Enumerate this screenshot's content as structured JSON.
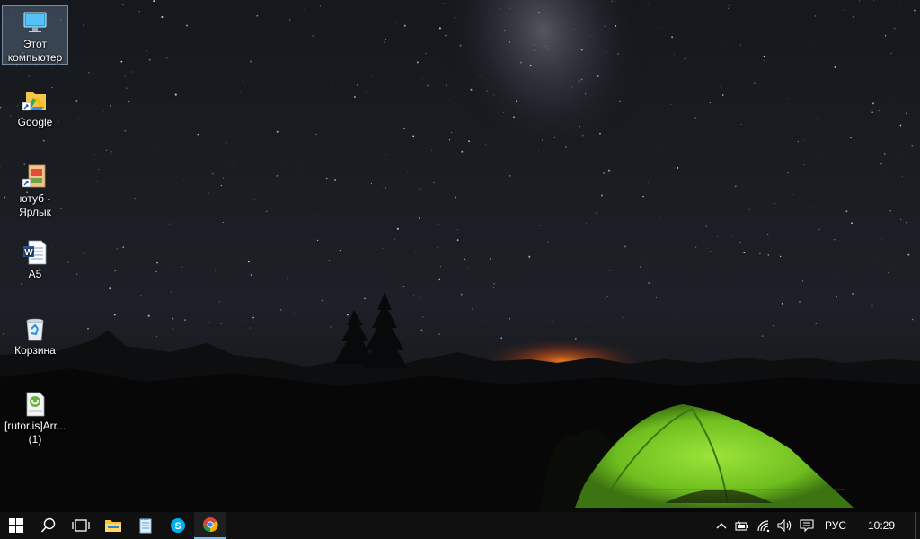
{
  "desktop": {
    "icons": [
      {
        "label": "Этот компьютер",
        "icon": "this-pc-icon",
        "selected": true
      },
      {
        "label": "Google",
        "icon": "google-drive-shortcut-icon"
      },
      {
        "label": "ютуб - Ярлык",
        "icon": "youtube-shortcut-icon"
      },
      {
        "label": "А5",
        "icon": "word-document-icon"
      },
      {
        "label": "Корзина",
        "icon": "recycle-bin-icon"
      },
      {
        "label": "[rutor.is]Arr... (1)",
        "icon": "torrent-file-icon"
      }
    ]
  },
  "taskbar": {
    "pinned": [
      {
        "name": "start-button",
        "icon": "windows-logo-icon"
      },
      {
        "name": "search-button",
        "icon": "search-icon"
      },
      {
        "name": "task-view-button",
        "icon": "task-view-icon"
      },
      {
        "name": "file-explorer-button",
        "icon": "folder-icon"
      },
      {
        "name": "notepad-button",
        "icon": "notepad-icon"
      },
      {
        "name": "skype-button",
        "icon": "skype-icon"
      },
      {
        "name": "chrome-button",
        "icon": "chrome-icon",
        "active": true
      }
    ],
    "tray": {
      "language": "РУС",
      "time": "10:29",
      "icons": [
        "chevron-up-icon",
        "battery-icon",
        "wifi-icon",
        "volume-icon",
        "action-center-icon"
      ]
    }
  },
  "colors": {
    "taskbar_bg": "#101010",
    "accent": "#76b9ed",
    "tent_green": "#7ed321",
    "horizon_glow": "#e0641a"
  }
}
